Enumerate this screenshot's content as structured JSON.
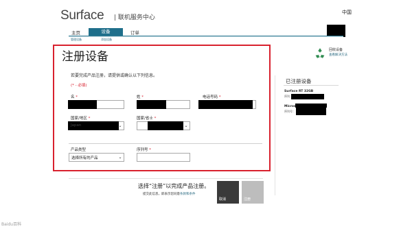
{
  "header": {
    "brand": "Surface",
    "subtitle": "| 联机服务中心",
    "region": "中国"
  },
  "nav": {
    "tabs": [
      {
        "label": "主页",
        "active": false
      },
      {
        "label": "设备",
        "active": true
      },
      {
        "label": "订单",
        "active": false
      }
    ],
    "sub_tabs": [
      "管理设备",
      "添加设备"
    ]
  },
  "recycle": {
    "label": "回收设备",
    "link": "查看解决方法"
  },
  "form": {
    "title": "注册设备",
    "intro": "若要完成产品注册，请提供或确认以下列信息。",
    "required_note": "(* - 必填)",
    "fields": {
      "first_name": {
        "label": "名",
        "required": true
      },
      "last_name": {
        "label": "姓",
        "required": true
      },
      "phone": {
        "label": "电话号码",
        "required": true
      },
      "country": {
        "label": "国家/地区",
        "required": true,
        "value": "Japan"
      },
      "province": {
        "label": "国家/省士",
        "required": true
      },
      "product_type": {
        "label": "产品类型",
        "value": "选择所有的产品"
      },
      "serial": {
        "label": "序列号",
        "required": true
      }
    }
  },
  "registered": {
    "title": "已注册设备",
    "devices": [
      {
        "name": "Surface RT 32GB",
        "serial_label": "序列"
      },
      {
        "name": "Microsoft 有效设备",
        "serial_label": "序列号："
      }
    ]
  },
  "footer": {
    "message": "选择“注册”以完成产品注册。",
    "sub_text": "提交此信息，即表示您同意",
    "sub_link": "条款和条件",
    "cancel_label": "取消",
    "register_label": "注册"
  },
  "watermark": "Baidu百科",
  "colors": {
    "accent": "#1f6f8b",
    "frame": "#d8202d",
    "link": "#2c6c83"
  }
}
